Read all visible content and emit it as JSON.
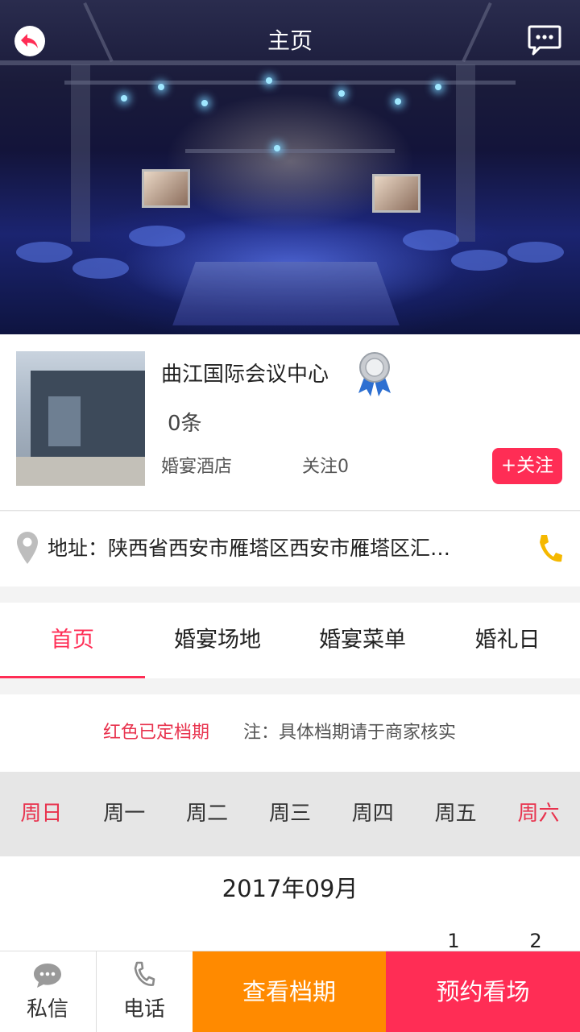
{
  "header": {
    "title": "主页",
    "back_icon": "back-arrow-icon",
    "message_icon": "chat-bubble-icon"
  },
  "venue": {
    "name": "曲江国际会议中心",
    "badge_icon": "medal-icon",
    "count": "0条",
    "type": "婚宴酒店",
    "follow_count": "关注0",
    "follow_button": "+关注"
  },
  "address": {
    "text": "地址：陕西省西安市雁塔区西安市雁塔区汇…",
    "pin_icon": "location-pin-icon",
    "phone_icon": "phone-icon"
  },
  "tabs": [
    {
      "label": "首页",
      "active": true
    },
    {
      "label": "婚宴场地",
      "active": false
    },
    {
      "label": "婚宴菜单",
      "active": false
    },
    {
      "label": "婚礼日",
      "active": false
    }
  ],
  "schedule_note": {
    "legend": "红色已定档期",
    "note": "注：具体档期请于商家核实"
  },
  "weekdays": [
    "周日",
    "周一",
    "周二",
    "周三",
    "周四",
    "周五",
    "周六"
  ],
  "calendar": {
    "month": "2017年09月",
    "visible_days": [
      "1",
      "2"
    ]
  },
  "bottom_bar": {
    "message_label": "私信",
    "phone_label": "电话",
    "schedule_button": "查看档期",
    "book_button": "预约看场"
  },
  "colors": {
    "accent_red": "#ff2d55",
    "accent_orange": "#ff8a00",
    "phone_yellow": "#f5b800"
  }
}
